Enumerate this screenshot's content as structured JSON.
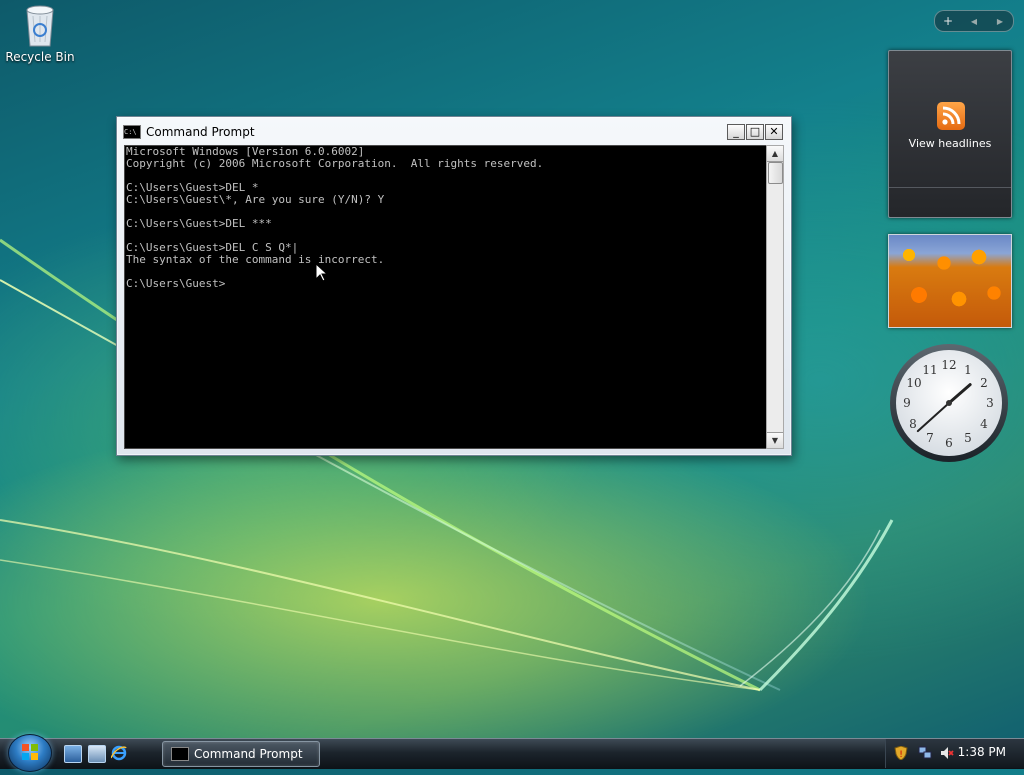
{
  "desktop": {
    "recycle_bin_label": "Recycle Bin"
  },
  "cmd_window": {
    "title": "Command Prompt",
    "icon": "console-icon",
    "console_lines": [
      "Microsoft Windows [Version 6.0.6002]",
      "Copyright (c) 2006 Microsoft Corporation.  All rights reserved.",
      "",
      "C:\\Users\\Guest>DEL *",
      "C:\\Users\\Guest\\*, Are you sure (Y/N)? Y",
      "",
      "C:\\Users\\Guest>DEL ***",
      "",
      "C:\\Users\\Guest>DEL C S Q*|",
      "The syntax of the command is incorrect.",
      "",
      "C:\\Users\\Guest>"
    ],
    "buttons": {
      "minimize": "_",
      "maximize": "□",
      "close": "✕"
    }
  },
  "sidebar": {
    "controls": {
      "add": "+",
      "prev": "◀",
      "next": "▶"
    },
    "feed_gadget": {
      "label": "View headlines",
      "icon": "rss-icon"
    },
    "clock": {
      "hour": 1,
      "minute": 38
    }
  },
  "taskbar": {
    "active_task": "Command Prompt",
    "clock_time": "1:38 PM",
    "colors": {
      "accent": "#2d7cc4"
    }
  }
}
